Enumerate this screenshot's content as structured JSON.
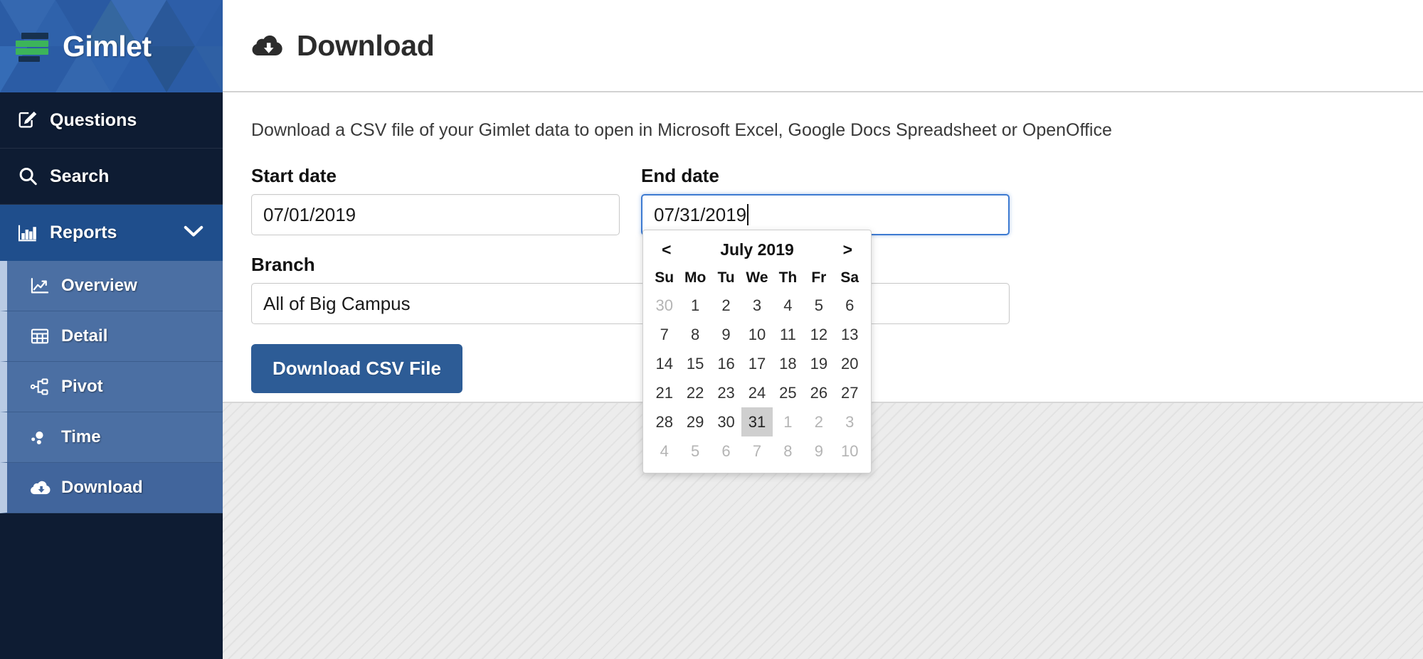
{
  "brand": {
    "name": "Gimlet",
    "logo_icon": "gimlet-bars-logo"
  },
  "sidebar": {
    "items": [
      {
        "label": "Questions",
        "icon": "edit-square-icon",
        "active": false
      },
      {
        "label": "Search",
        "icon": "search-icon",
        "active": false
      },
      {
        "label": "Reports",
        "icon": "bar-chart-icon",
        "active": true,
        "chevron": "chevron-down-icon"
      }
    ],
    "subitems": [
      {
        "label": "Overview",
        "icon": "line-chart-icon",
        "current": false
      },
      {
        "label": "Detail",
        "icon": "table-grid-icon",
        "current": false
      },
      {
        "label": "Pivot",
        "icon": "sitemap-icon",
        "current": false
      },
      {
        "label": "Time",
        "icon": "bubble-chart-icon",
        "current": false
      },
      {
        "label": "Download",
        "icon": "cloud-download-icon",
        "current": true
      }
    ]
  },
  "header": {
    "title": "Download",
    "icon": "cloud-download-icon"
  },
  "main": {
    "description": "Download a CSV file of your Gimlet data to open in Microsoft Excel, Google Docs Spreadsheet or OpenOffice",
    "start_date": {
      "label": "Start date",
      "value": "07/01/2019",
      "placeholder": ""
    },
    "end_date": {
      "label": "End date",
      "value": "07/31/2019",
      "placeholder": "",
      "focused": true
    },
    "branch": {
      "label": "Branch",
      "value": "All of Big Campus"
    },
    "download_button": "Download CSV File"
  },
  "datepicker": {
    "prev_label": "<",
    "next_label": ">",
    "month_title": "July 2019",
    "weekdays": [
      "Su",
      "Mo",
      "Tu",
      "We",
      "Th",
      "Fr",
      "Sa"
    ],
    "selected_day": "31",
    "weeks": [
      [
        {
          "d": "30",
          "m": true
        },
        {
          "d": "1",
          "m": false
        },
        {
          "d": "2",
          "m": false
        },
        {
          "d": "3",
          "m": false
        },
        {
          "d": "4",
          "m": false
        },
        {
          "d": "5",
          "m": false
        },
        {
          "d": "6",
          "m": false
        }
      ],
      [
        {
          "d": "7",
          "m": false
        },
        {
          "d": "8",
          "m": false
        },
        {
          "d": "9",
          "m": false
        },
        {
          "d": "10",
          "m": false
        },
        {
          "d": "11",
          "m": false
        },
        {
          "d": "12",
          "m": false
        },
        {
          "d": "13",
          "m": false
        }
      ],
      [
        {
          "d": "14",
          "m": false
        },
        {
          "d": "15",
          "m": false
        },
        {
          "d": "16",
          "m": false
        },
        {
          "d": "17",
          "m": false
        },
        {
          "d": "18",
          "m": false
        },
        {
          "d": "19",
          "m": false
        },
        {
          "d": "20",
          "m": false
        }
      ],
      [
        {
          "d": "21",
          "m": false
        },
        {
          "d": "22",
          "m": false
        },
        {
          "d": "23",
          "m": false
        },
        {
          "d": "24",
          "m": false
        },
        {
          "d": "25",
          "m": false
        },
        {
          "d": "26",
          "m": false
        },
        {
          "d": "27",
          "m": false
        }
      ],
      [
        {
          "d": "28",
          "m": false
        },
        {
          "d": "29",
          "m": false
        },
        {
          "d": "30",
          "m": false
        },
        {
          "d": "31",
          "m": false,
          "sel": true
        },
        {
          "d": "1",
          "m": true
        },
        {
          "d": "2",
          "m": true
        },
        {
          "d": "3",
          "m": true
        }
      ],
      [
        {
          "d": "4",
          "m": true
        },
        {
          "d": "5",
          "m": true
        },
        {
          "d": "6",
          "m": true
        },
        {
          "d": "7",
          "m": true
        },
        {
          "d": "8",
          "m": true
        },
        {
          "d": "9",
          "m": true
        },
        {
          "d": "10",
          "m": true
        }
      ]
    ]
  },
  "colors": {
    "brand_blue": "#2b5ca5",
    "sidebar_dark": "#0e1c33",
    "sidebar_active": "#1f4e8c",
    "subnav": "#4b6fa3",
    "subnav_current": "#41659c",
    "accent_green": "#3cb45a",
    "button_blue": "#2d5c96",
    "focus_blue": "#3d7ad1"
  }
}
